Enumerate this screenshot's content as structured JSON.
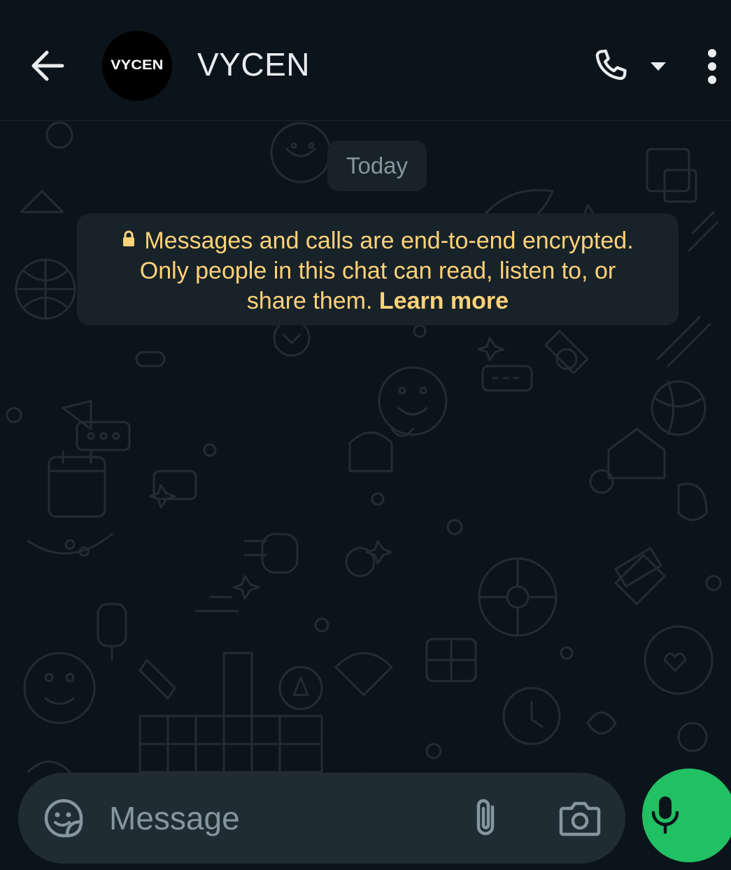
{
  "header": {
    "contact_name": "VYCEN",
    "avatar_text": "VYCEN"
  },
  "chat": {
    "date_label": "Today",
    "encryption_notice": {
      "line1": "Messages and calls are end-to-end encrypted.",
      "line2": "Only people in this chat can read, listen to, or",
      "line3_prefix": "share them.",
      "link_label": "Learn more"
    }
  },
  "composer": {
    "placeholder": "Message"
  },
  "icons": {
    "back": "arrow-left-icon",
    "call": "phone-icon",
    "call_dropdown": "caret-down-icon",
    "menu": "more-vertical-icon",
    "emoji": "sticker-icon",
    "attach": "paperclip-icon",
    "camera": "camera-icon",
    "mic": "microphone-icon",
    "lock": "lock-icon"
  },
  "colors": {
    "background": "#0b141a",
    "bubble": "#182229",
    "notice_text": "#ffd279",
    "accent_green": "#21c063",
    "composer_bg": "#1f2c33",
    "muted_text": "#8696a0"
  }
}
